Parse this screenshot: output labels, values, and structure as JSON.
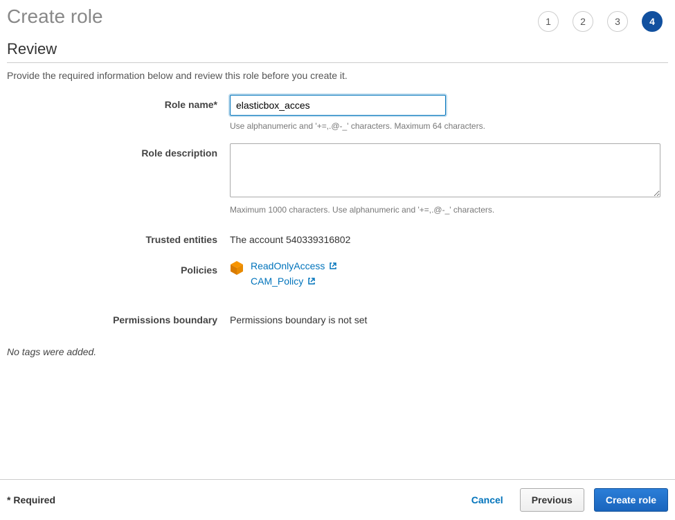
{
  "header": {
    "title": "Create role"
  },
  "stepper": {
    "steps": [
      "1",
      "2",
      "3",
      "4"
    ],
    "active_index": 3
  },
  "review": {
    "subtitle": "Review",
    "instructions": "Provide the required information below and review this role before you create it."
  },
  "form": {
    "role_name": {
      "label": "Role name*",
      "value": "elasticbox_acces",
      "helper": "Use alphanumeric and '+=,.@-_' characters. Maximum 64 characters."
    },
    "role_description": {
      "label": "Role description",
      "value": "",
      "helper": "Maximum 1000 characters. Use alphanumeric and '+=,.@-_' characters."
    },
    "trusted_entities": {
      "label": "Trusted entities",
      "value": "The account 540339316802"
    },
    "policies": {
      "label": "Policies",
      "items": [
        "ReadOnlyAccess",
        "CAM_Policy"
      ]
    },
    "permissions_boundary": {
      "label": "Permissions boundary",
      "value": "Permissions boundary is not set"
    }
  },
  "tags_note": "No tags were added.",
  "footer": {
    "required": "* Required",
    "cancel": "Cancel",
    "previous": "Previous",
    "create": "Create role"
  }
}
